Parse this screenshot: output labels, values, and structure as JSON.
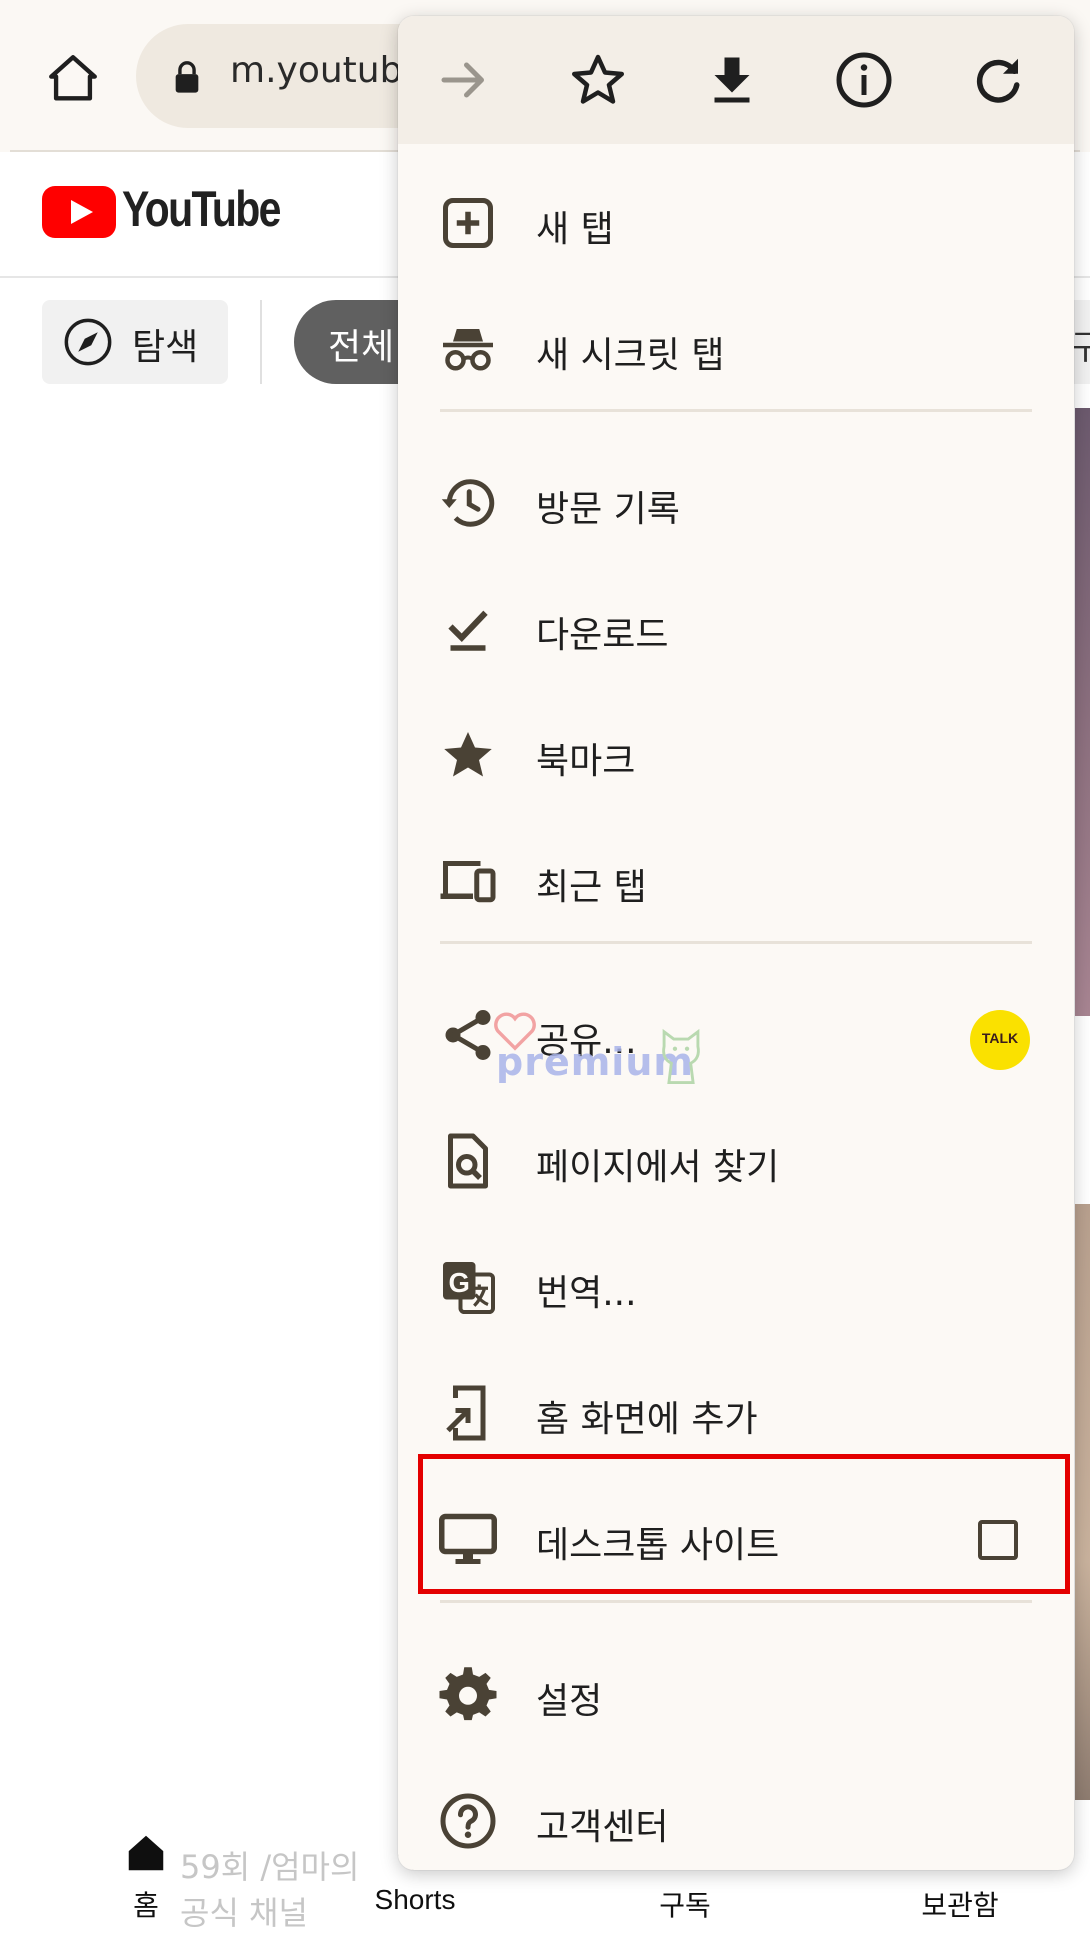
{
  "browser": {
    "url": "m.youtube",
    "icons": {
      "home": "home-icon",
      "lock": "lock-icon",
      "forward": "forward-arrow-icon",
      "bookmark": "star-outline-icon",
      "download": "download-icon",
      "info": "info-icon",
      "reload": "reload-icon"
    }
  },
  "youtube": {
    "logo_text": "YouTube",
    "chips": {
      "explore": "탐색",
      "all": "전체",
      "partial": "구"
    },
    "bottom_nav": {
      "home": "홈",
      "shorts": "Shorts",
      "subscriptions": "구독",
      "library": "보관함"
    },
    "faded_video_title": "59회 /엄마의",
    "faded_channel": "공식 채널"
  },
  "menu": {
    "sections": [
      [
        {
          "label": "새 탭",
          "icon": "new-tab-icon"
        },
        {
          "label": "새 시크릿 탭",
          "icon": "incognito-icon"
        }
      ],
      [
        {
          "label": "방문 기록",
          "icon": "history-icon"
        },
        {
          "label": "다운로드",
          "icon": "downloads-check-icon"
        },
        {
          "label": "북마크",
          "icon": "bookmarks-star-icon"
        },
        {
          "label": "최근 탭",
          "icon": "recent-tabs-devices-icon"
        }
      ],
      [
        {
          "label": "공유...",
          "icon": "share-icon",
          "badge": "TALK"
        },
        {
          "label": "페이지에서 찾기",
          "icon": "find-in-page-icon"
        },
        {
          "label": "번역...",
          "icon": "translate-icon"
        },
        {
          "label": "홈 화면에 추가",
          "icon": "add-to-home-icon"
        },
        {
          "label": "데스크톱 사이트",
          "icon": "desktop-icon",
          "checked": false
        }
      ],
      [
        {
          "label": "설정",
          "icon": "settings-gear-icon"
        },
        {
          "label": "고객센터",
          "icon": "help-icon"
        }
      ]
    ]
  },
  "watermark": {
    "text": "premium"
  },
  "colors": {
    "menu_bg": "#fcf9f5",
    "menu_toolbar_bg": "#f3eee7",
    "icon_color": "#4a4235",
    "highlight": "#e40000",
    "youtube_red": "#ff0000",
    "talk_yellow": "#fae100"
  }
}
